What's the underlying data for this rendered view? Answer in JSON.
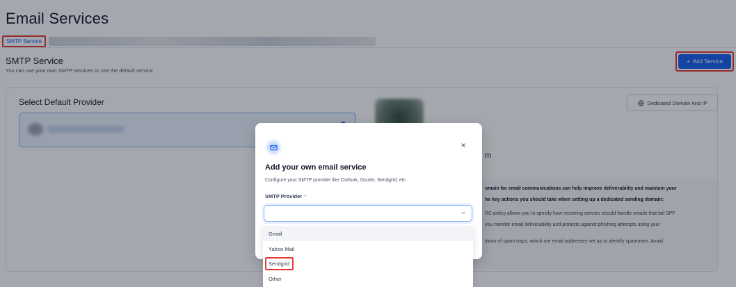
{
  "page": {
    "title": "Email Services"
  },
  "tabs": {
    "active_label": "SMTP Service"
  },
  "section": {
    "title": "SMTP Service",
    "subtitle": "You can use your own SMTP services or use the default service",
    "add_button_label": "Add Service",
    "add_button_icon": "+"
  },
  "card": {
    "title": "Select Default Provider",
    "dedicated_button_label": "Dedicated Domain And IP",
    "dedicated_button_icon": "globe-icon"
  },
  "right_panel": {
    "heading_fragment": "m",
    "info_lines": [
      {
        "text": "omain for email communications can help improve deliverability and maintain your",
        "bold": true
      },
      {
        "text": "he key actions you should take when setting up a dedicated sending domain:",
        "bold": true
      },
      {
        "text": "RC policy allows you to specify how receiving servers should handle emails that fail SPF",
        "bold": false
      },
      {
        "text": "you monitor email deliverability and protects against phishing attempts using your",
        "bold": false
      },
      {
        "text": "itious of spam traps, which are email addresses set up to identify spammers. Avoid",
        "bold": false
      }
    ]
  },
  "modal": {
    "icon": "mail-icon",
    "title": "Add your own email service",
    "subtitle": "Configure your SMTP provider like Outlook, Gsuite, Sendgrid, etc",
    "field_label": "SMTP Provider",
    "required_mark": "*",
    "select_value": "",
    "close_glyph": "×"
  },
  "dropdown": {
    "options": [
      "Gmail",
      "Yahoo Mail",
      "Sendgrid",
      "Other"
    ],
    "hovered_index": 0,
    "highlighted_index": 2
  },
  "colors": {
    "primary": "#155eef",
    "highlight_box": "#e53935",
    "overlay": "rgba(16, 24, 40, 0.38)"
  }
}
